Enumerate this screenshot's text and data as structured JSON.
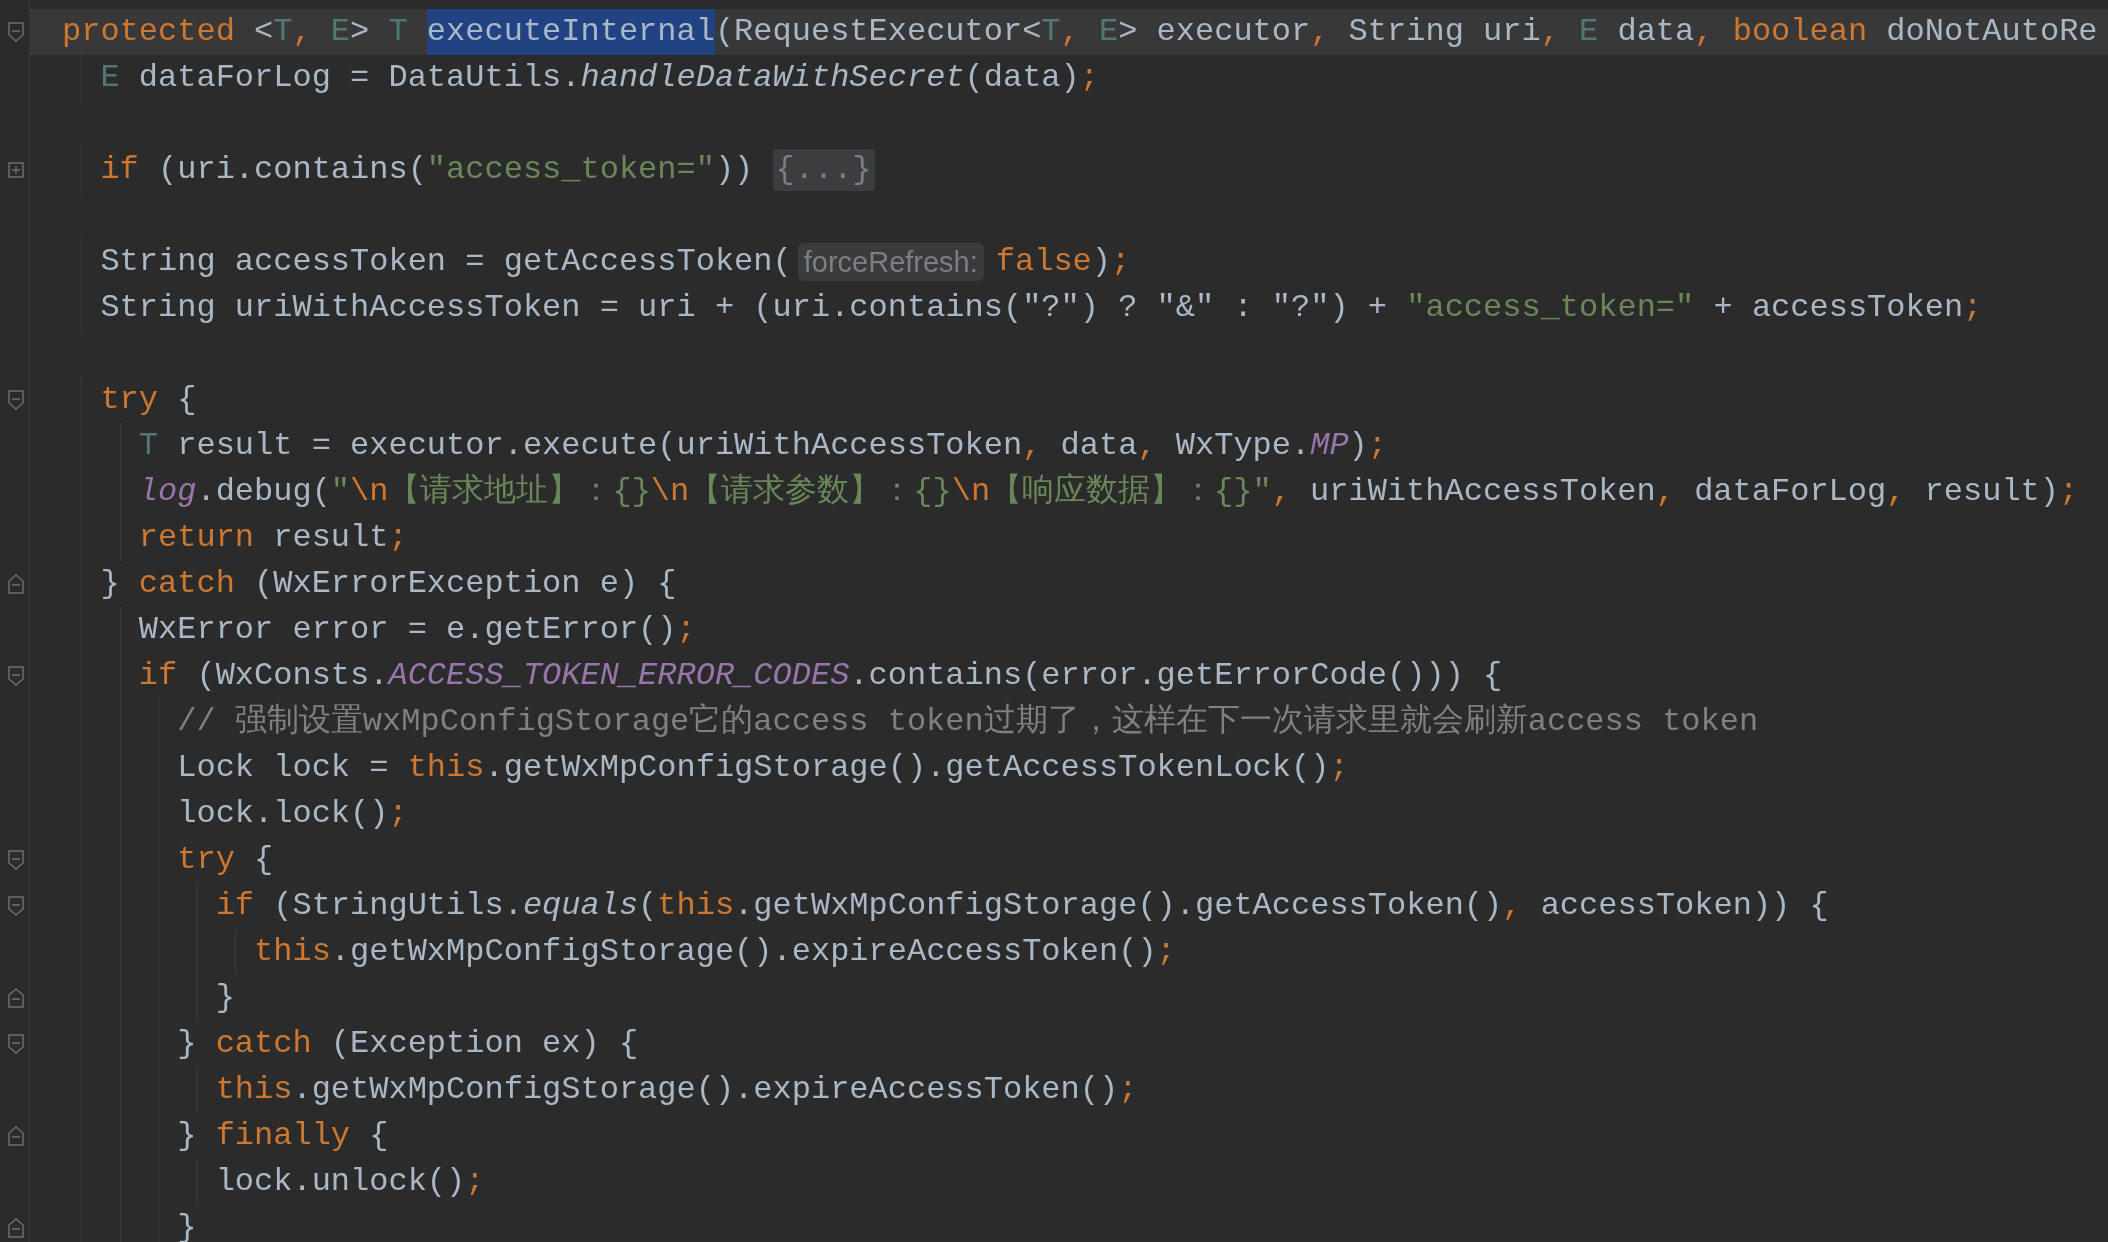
{
  "editor": {
    "lines": [
      {
        "current": true,
        "kind": "start",
        "tokens": [
          {
            "kind": "keyword",
            "text": "protected"
          },
          {
            "kind": "plain",
            "text": " <"
          },
          {
            "kind": "type",
            "text": "T"
          },
          {
            "kind": "punct",
            "text": ", "
          },
          {
            "kind": "type",
            "text": "E"
          },
          {
            "kind": "plain",
            "text": "> "
          },
          {
            "kind": "type",
            "text": "T "
          },
          {
            "kind": "selected",
            "text": "executeInternal"
          },
          {
            "kind": "plain",
            "text": "(RequestExecutor<"
          },
          {
            "kind": "type",
            "text": "T"
          },
          {
            "kind": "punct",
            "text": ", "
          },
          {
            "kind": "type",
            "text": "E"
          },
          {
            "kind": "plain",
            "text": "> executor"
          },
          {
            "kind": "punct",
            "text": ", "
          },
          {
            "kind": "plain",
            "text": "String uri"
          },
          {
            "kind": "punct",
            "text": ", "
          },
          {
            "kind": "type",
            "text": "E"
          },
          {
            "kind": "plain",
            "text": " data"
          },
          {
            "kind": "punct",
            "text": ", "
          },
          {
            "kind": "keyword",
            "text": "boolean"
          },
          {
            "kind": "plain",
            "text": " doNotAutoRe"
          }
        ]
      },
      {
        "current": false,
        "kind": "plain",
        "tokens": [
          {
            "kind": "type",
            "text": "  E"
          },
          {
            "kind": "plain",
            "text": " dataForLog = DataUtils."
          },
          {
            "kind": "italic",
            "text": "handleDataWithSecret"
          },
          {
            "kind": "plain",
            "text": "(data)"
          },
          {
            "kind": "punct",
            "text": ";"
          }
        ]
      },
      {
        "current": false,
        "kind": "plain"
      },
      {
        "current": false,
        "kind": "collapsed",
        "tokens": [
          {
            "kind": "keyword",
            "text": "  if"
          },
          {
            "kind": "plain",
            "text": " (uri.contains("
          },
          {
            "kind": "string",
            "text": "\"access_token=\""
          },
          {
            "kind": "plain",
            "text": ")) "
          },
          {
            "kind": "folded",
            "text": "{...}"
          }
        ]
      },
      {
        "current": false,
        "kind": "plain"
      },
      {
        "current": false,
        "kind": "plain",
        "tokens": [
          {
            "kind": "plain",
            "text": "  String accessToken = getAccessToken("
          },
          {
            "kind": "hint",
            "text": "forceRefresh:"
          },
          {
            "kind": "keyword",
            "text": "false"
          },
          {
            "kind": "plain",
            "text": ")"
          },
          {
            "kind": "punct",
            "text": ";"
          }
        ]
      },
      {
        "current": false,
        "kind": "plain",
        "tokens": [
          {
            "kind": "plain",
            "text": "  String uriWithAccessToken = uri + (uri.contains(\"?\") ? \"&\" : \"?\") + "
          },
          {
            "kind": "string",
            "text": "\"access_token=\""
          },
          {
            "kind": "plain",
            "text": " + accessToken"
          },
          {
            "kind": "punct",
            "text": ";"
          }
        ]
      },
      {
        "current": false,
        "kind": "plain"
      },
      {
        "current": false,
        "kind": "start",
        "tokens": [
          {
            "kind": "keyword",
            "text": "  try"
          },
          {
            "kind": "plain",
            "text": " {"
          }
        ]
      },
      {
        "current": false,
        "kind": "plain",
        "tokens": [
          {
            "kind": "type",
            "text": "    T"
          },
          {
            "kind": "plain",
            "text": " result = executor.execute(uriWithAccessToken"
          },
          {
            "kind": "punct",
            "text": ", "
          },
          {
            "kind": "plain",
            "text": "data"
          },
          {
            "kind": "punct",
            "text": ", "
          },
          {
            "kind": "plain",
            "text": "WxType."
          },
          {
            "kind": "constant",
            "text": "MP"
          },
          {
            "kind": "plain",
            "text": ")"
          },
          {
            "kind": "punct",
            "text": ";"
          }
        ]
      },
      {
        "current": false,
        "kind": "plain",
        "tokens": [
          {
            "kind": "constant",
            "text": "    log"
          },
          {
            "kind": "plain",
            "text": ".debug("
          },
          {
            "kind": "string",
            "text": "\""
          },
          {
            "kind": "escape",
            "text": "\\n"
          },
          {
            "kind": "string",
            "text": "【请求地址】：{}"
          },
          {
            "kind": "escape",
            "text": "\\n"
          },
          {
            "kind": "string",
            "text": "【请求参数】：{}"
          },
          {
            "kind": "escape",
            "text": "\\n"
          },
          {
            "kind": "string",
            "text": "【响应数据】：{}\""
          },
          {
            "kind": "punct",
            "text": ", "
          },
          {
            "kind": "plain",
            "text": "uriWithAccessToken"
          },
          {
            "kind": "punct",
            "text": ", "
          },
          {
            "kind": "plain",
            "text": "dataForLog"
          },
          {
            "kind": "punct",
            "text": ", "
          },
          {
            "kind": "plain",
            "text": "result)"
          },
          {
            "kind": "punct",
            "text": ";"
          }
        ]
      },
      {
        "current": false,
        "kind": "plain",
        "tokens": [
          {
            "kind": "keyword",
            "text": "    return"
          },
          {
            "kind": "plain",
            "text": " result"
          },
          {
            "kind": "punct",
            "text": ";"
          }
        ]
      },
      {
        "current": false,
        "kind": "end",
        "tokens": [
          {
            "kind": "plain",
            "text": "  } "
          },
          {
            "kind": "keyword",
            "text": "catch"
          },
          {
            "kind": "plain",
            "text": " (WxErrorException e) {"
          }
        ]
      },
      {
        "current": false,
        "kind": "plain",
        "tokens": [
          {
            "kind": "plain",
            "text": "    WxError error = e.getError()"
          },
          {
            "kind": "punct",
            "text": ";"
          }
        ]
      },
      {
        "current": false,
        "kind": "start",
        "tokens": [
          {
            "kind": "keyword",
            "text": "    if"
          },
          {
            "kind": "plain",
            "text": " (WxConsts."
          },
          {
            "kind": "constant",
            "text": "ACCESS_TOKEN_ERROR_CODES"
          },
          {
            "kind": "plain",
            "text": ".contains(error.getErrorCode())) {"
          }
        ]
      },
      {
        "current": false,
        "kind": "plain",
        "tokens": [
          {
            "kind": "comment",
            "text": "      // 强制设置wxMpConfigStorage它的access token过期了，这样在下一次请求里就会刷新access token"
          }
        ]
      },
      {
        "current": false,
        "kind": "plain",
        "tokens": [
          {
            "kind": "plain",
            "text": "      Lock lock = "
          },
          {
            "kind": "keyword",
            "text": "this"
          },
          {
            "kind": "plain",
            "text": ".getWxMpConfigStorage().getAccessTokenLock()"
          },
          {
            "kind": "punct",
            "text": ";"
          }
        ]
      },
      {
        "current": false,
        "kind": "plain",
        "tokens": [
          {
            "kind": "plain",
            "text": "      lock.lock()"
          },
          {
            "kind": "punct",
            "text": ";"
          }
        ]
      },
      {
        "current": false,
        "kind": "start",
        "tokens": [
          {
            "kind": "keyword",
            "text": "      try"
          },
          {
            "kind": "plain",
            "text": " {"
          }
        ]
      },
      {
        "current": false,
        "kind": "start",
        "tokens": [
          {
            "kind": "keyword",
            "text": "        if"
          },
          {
            "kind": "plain",
            "text": " (StringUtils."
          },
          {
            "kind": "italic",
            "text": "equals"
          },
          {
            "kind": "plain",
            "text": "("
          },
          {
            "kind": "keyword",
            "text": "this"
          },
          {
            "kind": "plain",
            "text": ".getWxMpConfigStorage().getAccessToken()"
          },
          {
            "kind": "punct",
            "text": ", "
          },
          {
            "kind": "plain",
            "text": "accessToken)) {"
          }
        ]
      },
      {
        "current": false,
        "kind": "plain",
        "tokens": [
          {
            "kind": "keyword",
            "text": "          this"
          },
          {
            "kind": "plain",
            "text": ".getWxMpConfigStorage().expireAccessToken()"
          },
          {
            "kind": "punct",
            "text": ";"
          }
        ]
      },
      {
        "current": false,
        "kind": "end",
        "tokens": [
          {
            "kind": "plain",
            "text": "        }"
          }
        ]
      },
      {
        "current": false,
        "kind": "start",
        "tokens": [
          {
            "kind": "plain",
            "text": "      } "
          },
          {
            "kind": "keyword",
            "text": "catch"
          },
          {
            "kind": "plain",
            "text": " (Exception ex) {"
          }
        ]
      },
      {
        "current": false,
        "kind": "plain",
        "tokens": [
          {
            "kind": "keyword",
            "text": "        this"
          },
          {
            "kind": "plain",
            "text": ".getWxMpConfigStorage().expireAccessToken()"
          },
          {
            "kind": "punct",
            "text": ";"
          }
        ]
      },
      {
        "current": false,
        "kind": "end",
        "tokens": [
          {
            "kind": "plain",
            "text": "      } "
          },
          {
            "kind": "keyword",
            "text": "finally"
          },
          {
            "kind": "plain",
            "text": " {"
          }
        ]
      },
      {
        "current": false,
        "kind": "plain",
        "tokens": [
          {
            "kind": "plain",
            "text": "        lock.unlock()"
          },
          {
            "kind": "punct",
            "text": ";"
          }
        ]
      },
      {
        "current": false,
        "kind": "end",
        "tokens": [
          {
            "kind": "plain",
            "text": "      }"
          }
        ]
      }
    ]
  }
}
